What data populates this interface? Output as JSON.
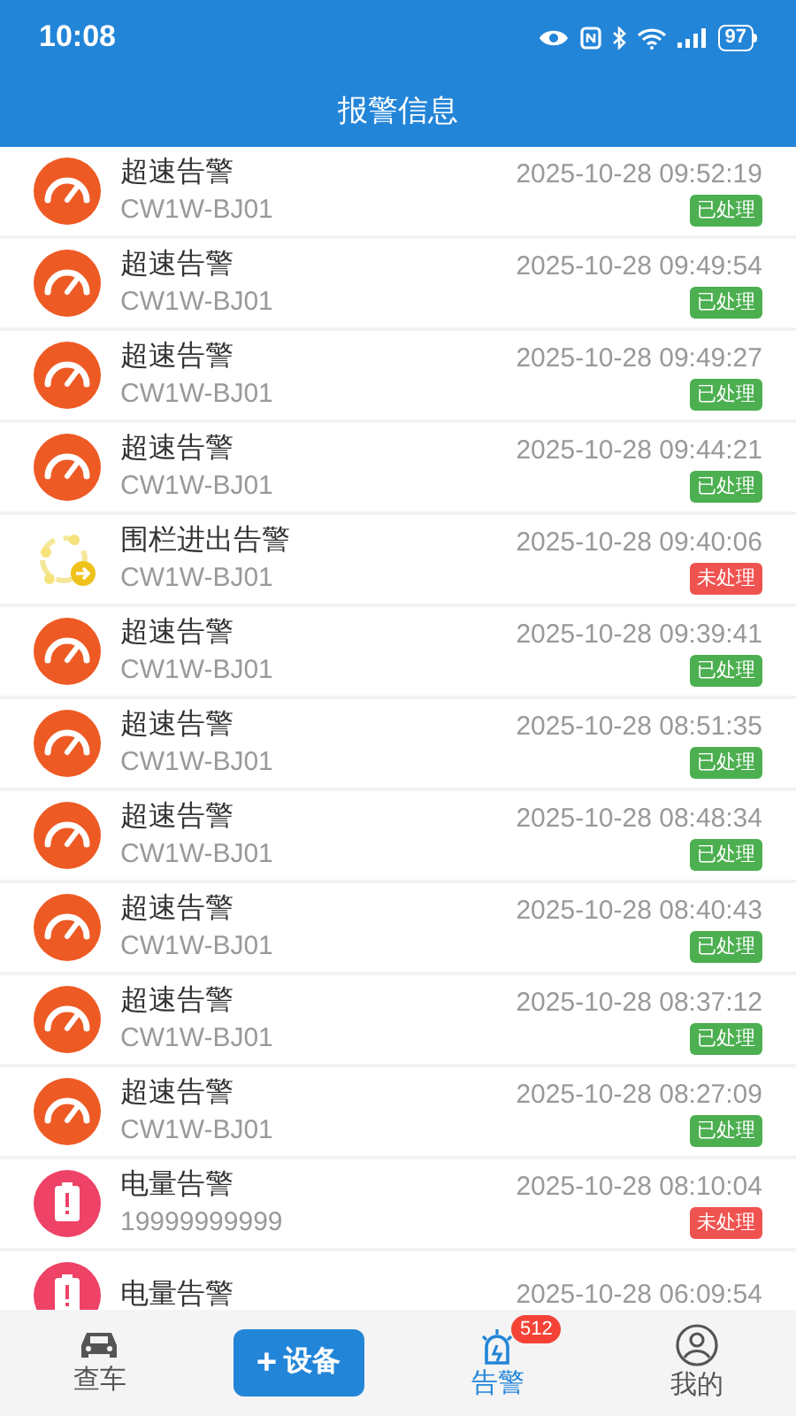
{
  "status_bar": {
    "time": "10:08",
    "battery": "97"
  },
  "header": {
    "title": "报警信息"
  },
  "alerts": [
    {
      "kind": "speed",
      "title": "超速告警",
      "device": "CW1W-BJ01",
      "time": "2025-10-28 09:52:19",
      "handled": true,
      "status": "已处理"
    },
    {
      "kind": "speed",
      "title": "超速告警",
      "device": "CW1W-BJ01",
      "time": "2025-10-28 09:49:54",
      "handled": true,
      "status": "已处理"
    },
    {
      "kind": "speed",
      "title": "超速告警",
      "device": "CW1W-BJ01",
      "time": "2025-10-28 09:49:27",
      "handled": true,
      "status": "已处理"
    },
    {
      "kind": "speed",
      "title": "超速告警",
      "device": "CW1W-BJ01",
      "time": "2025-10-28 09:44:21",
      "handled": true,
      "status": "已处理"
    },
    {
      "kind": "fence",
      "title": "围栏进出告警",
      "device": "CW1W-BJ01",
      "time": "2025-10-28 09:40:06",
      "handled": false,
      "status": "未处理"
    },
    {
      "kind": "speed",
      "title": "超速告警",
      "device": "CW1W-BJ01",
      "time": "2025-10-28 09:39:41",
      "handled": true,
      "status": "已处理"
    },
    {
      "kind": "speed",
      "title": "超速告警",
      "device": "CW1W-BJ01",
      "time": "2025-10-28 08:51:35",
      "handled": true,
      "status": "已处理"
    },
    {
      "kind": "speed",
      "title": "超速告警",
      "device": "CW1W-BJ01",
      "time": "2025-10-28 08:48:34",
      "handled": true,
      "status": "已处理"
    },
    {
      "kind": "speed",
      "title": "超速告警",
      "device": "CW1W-BJ01",
      "time": "2025-10-28 08:40:43",
      "handled": true,
      "status": "已处理"
    },
    {
      "kind": "speed",
      "title": "超速告警",
      "device": "CW1W-BJ01",
      "time": "2025-10-28 08:37:12",
      "handled": true,
      "status": "已处理"
    },
    {
      "kind": "speed",
      "title": "超速告警",
      "device": "CW1W-BJ01",
      "time": "2025-10-28 08:27:09",
      "handled": true,
      "status": "已处理"
    },
    {
      "kind": "battery",
      "title": "电量告警",
      "device": "19999999999",
      "time": "2025-10-28 08:10:04",
      "handled": false,
      "status": "未处理"
    },
    {
      "kind": "battery",
      "title": "电量告警",
      "time": "2025-10-28 06:09:54"
    }
  ],
  "nav": [
    {
      "kind": "car",
      "label": "查车",
      "selected": false
    },
    {
      "kind": "add",
      "label": "设备",
      "icon": "+"
    },
    {
      "kind": "alarm",
      "label": "告警",
      "selected": true,
      "badge": "512"
    },
    {
      "kind": "user",
      "label": "我的",
      "selected": false
    }
  ]
}
